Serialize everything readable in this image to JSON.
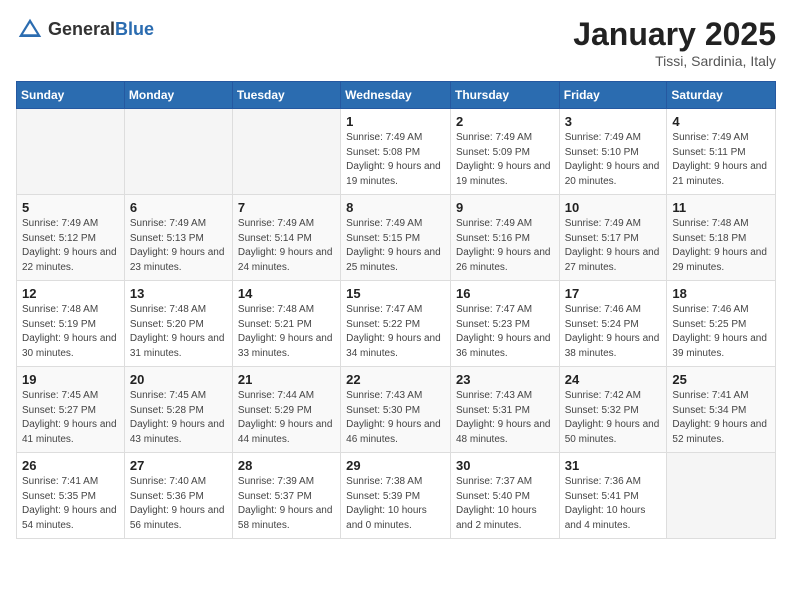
{
  "header": {
    "logo_general": "General",
    "logo_blue": "Blue",
    "month": "January 2025",
    "location": "Tissi, Sardinia, Italy"
  },
  "weekdays": [
    "Sunday",
    "Monday",
    "Tuesday",
    "Wednesday",
    "Thursday",
    "Friday",
    "Saturday"
  ],
  "weeks": [
    [
      {
        "day": "",
        "sunrise": "",
        "sunset": "",
        "daylight": ""
      },
      {
        "day": "",
        "sunrise": "",
        "sunset": "",
        "daylight": ""
      },
      {
        "day": "",
        "sunrise": "",
        "sunset": "",
        "daylight": ""
      },
      {
        "day": "1",
        "sunrise": "Sunrise: 7:49 AM",
        "sunset": "Sunset: 5:08 PM",
        "daylight": "Daylight: 9 hours and 19 minutes."
      },
      {
        "day": "2",
        "sunrise": "Sunrise: 7:49 AM",
        "sunset": "Sunset: 5:09 PM",
        "daylight": "Daylight: 9 hours and 19 minutes."
      },
      {
        "day": "3",
        "sunrise": "Sunrise: 7:49 AM",
        "sunset": "Sunset: 5:10 PM",
        "daylight": "Daylight: 9 hours and 20 minutes."
      },
      {
        "day": "4",
        "sunrise": "Sunrise: 7:49 AM",
        "sunset": "Sunset: 5:11 PM",
        "daylight": "Daylight: 9 hours and 21 minutes."
      }
    ],
    [
      {
        "day": "5",
        "sunrise": "Sunrise: 7:49 AM",
        "sunset": "Sunset: 5:12 PM",
        "daylight": "Daylight: 9 hours and 22 minutes."
      },
      {
        "day": "6",
        "sunrise": "Sunrise: 7:49 AM",
        "sunset": "Sunset: 5:13 PM",
        "daylight": "Daylight: 9 hours and 23 minutes."
      },
      {
        "day": "7",
        "sunrise": "Sunrise: 7:49 AM",
        "sunset": "Sunset: 5:14 PM",
        "daylight": "Daylight: 9 hours and 24 minutes."
      },
      {
        "day": "8",
        "sunrise": "Sunrise: 7:49 AM",
        "sunset": "Sunset: 5:15 PM",
        "daylight": "Daylight: 9 hours and 25 minutes."
      },
      {
        "day": "9",
        "sunrise": "Sunrise: 7:49 AM",
        "sunset": "Sunset: 5:16 PM",
        "daylight": "Daylight: 9 hours and 26 minutes."
      },
      {
        "day": "10",
        "sunrise": "Sunrise: 7:49 AM",
        "sunset": "Sunset: 5:17 PM",
        "daylight": "Daylight: 9 hours and 27 minutes."
      },
      {
        "day": "11",
        "sunrise": "Sunrise: 7:48 AM",
        "sunset": "Sunset: 5:18 PM",
        "daylight": "Daylight: 9 hours and 29 minutes."
      }
    ],
    [
      {
        "day": "12",
        "sunrise": "Sunrise: 7:48 AM",
        "sunset": "Sunset: 5:19 PM",
        "daylight": "Daylight: 9 hours and 30 minutes."
      },
      {
        "day": "13",
        "sunrise": "Sunrise: 7:48 AM",
        "sunset": "Sunset: 5:20 PM",
        "daylight": "Daylight: 9 hours and 31 minutes."
      },
      {
        "day": "14",
        "sunrise": "Sunrise: 7:48 AM",
        "sunset": "Sunset: 5:21 PM",
        "daylight": "Daylight: 9 hours and 33 minutes."
      },
      {
        "day": "15",
        "sunrise": "Sunrise: 7:47 AM",
        "sunset": "Sunset: 5:22 PM",
        "daylight": "Daylight: 9 hours and 34 minutes."
      },
      {
        "day": "16",
        "sunrise": "Sunrise: 7:47 AM",
        "sunset": "Sunset: 5:23 PM",
        "daylight": "Daylight: 9 hours and 36 minutes."
      },
      {
        "day": "17",
        "sunrise": "Sunrise: 7:46 AM",
        "sunset": "Sunset: 5:24 PM",
        "daylight": "Daylight: 9 hours and 38 minutes."
      },
      {
        "day": "18",
        "sunrise": "Sunrise: 7:46 AM",
        "sunset": "Sunset: 5:25 PM",
        "daylight": "Daylight: 9 hours and 39 minutes."
      }
    ],
    [
      {
        "day": "19",
        "sunrise": "Sunrise: 7:45 AM",
        "sunset": "Sunset: 5:27 PM",
        "daylight": "Daylight: 9 hours and 41 minutes."
      },
      {
        "day": "20",
        "sunrise": "Sunrise: 7:45 AM",
        "sunset": "Sunset: 5:28 PM",
        "daylight": "Daylight: 9 hours and 43 minutes."
      },
      {
        "day": "21",
        "sunrise": "Sunrise: 7:44 AM",
        "sunset": "Sunset: 5:29 PM",
        "daylight": "Daylight: 9 hours and 44 minutes."
      },
      {
        "day": "22",
        "sunrise": "Sunrise: 7:43 AM",
        "sunset": "Sunset: 5:30 PM",
        "daylight": "Daylight: 9 hours and 46 minutes."
      },
      {
        "day": "23",
        "sunrise": "Sunrise: 7:43 AM",
        "sunset": "Sunset: 5:31 PM",
        "daylight": "Daylight: 9 hours and 48 minutes."
      },
      {
        "day": "24",
        "sunrise": "Sunrise: 7:42 AM",
        "sunset": "Sunset: 5:32 PM",
        "daylight": "Daylight: 9 hours and 50 minutes."
      },
      {
        "day": "25",
        "sunrise": "Sunrise: 7:41 AM",
        "sunset": "Sunset: 5:34 PM",
        "daylight": "Daylight: 9 hours and 52 minutes."
      }
    ],
    [
      {
        "day": "26",
        "sunrise": "Sunrise: 7:41 AM",
        "sunset": "Sunset: 5:35 PM",
        "daylight": "Daylight: 9 hours and 54 minutes."
      },
      {
        "day": "27",
        "sunrise": "Sunrise: 7:40 AM",
        "sunset": "Sunset: 5:36 PM",
        "daylight": "Daylight: 9 hours and 56 minutes."
      },
      {
        "day": "28",
        "sunrise": "Sunrise: 7:39 AM",
        "sunset": "Sunset: 5:37 PM",
        "daylight": "Daylight: 9 hours and 58 minutes."
      },
      {
        "day": "29",
        "sunrise": "Sunrise: 7:38 AM",
        "sunset": "Sunset: 5:39 PM",
        "daylight": "Daylight: 10 hours and 0 minutes."
      },
      {
        "day": "30",
        "sunrise": "Sunrise: 7:37 AM",
        "sunset": "Sunset: 5:40 PM",
        "daylight": "Daylight: 10 hours and 2 minutes."
      },
      {
        "day": "31",
        "sunrise": "Sunrise: 7:36 AM",
        "sunset": "Sunset: 5:41 PM",
        "daylight": "Daylight: 10 hours and 4 minutes."
      },
      {
        "day": "",
        "sunrise": "",
        "sunset": "",
        "daylight": ""
      }
    ]
  ]
}
